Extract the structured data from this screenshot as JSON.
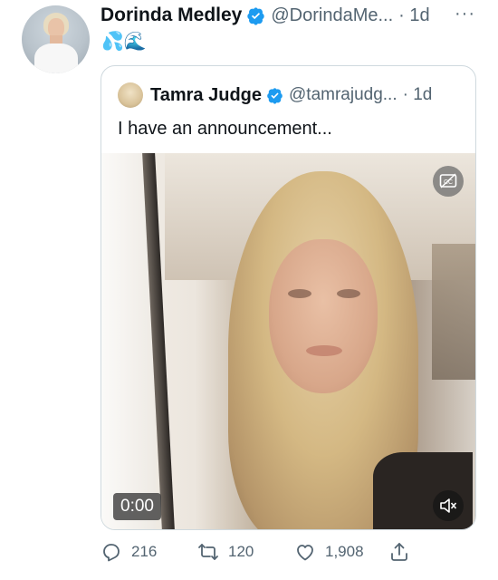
{
  "tweet": {
    "author_name": "Dorinda Medley",
    "author_handle": "@DorindaMe...",
    "separator_time": "· 1d",
    "more_label": "···",
    "text": "💦🌊",
    "verified": true
  },
  "quoted": {
    "author_name": "Tamra Judge",
    "author_handle": "@tamrajudg...",
    "separator_time": "· 1d",
    "text": "I have an announcement...",
    "verified": true,
    "video": {
      "timer": "0:00",
      "captions_icon": "captions-icon",
      "mute_icon": "muted-speaker-icon"
    }
  },
  "actions": {
    "reply_count": "216",
    "retweet_count": "120",
    "like_count": "1,908",
    "icons": [
      "reply-icon",
      "retweet-icon",
      "like-icon",
      "share-icon"
    ]
  },
  "colors": {
    "text_primary": "#0f1419",
    "text_secondary": "#536471",
    "verified_blue": "#1d9bf0",
    "border": "#cfd9de"
  }
}
